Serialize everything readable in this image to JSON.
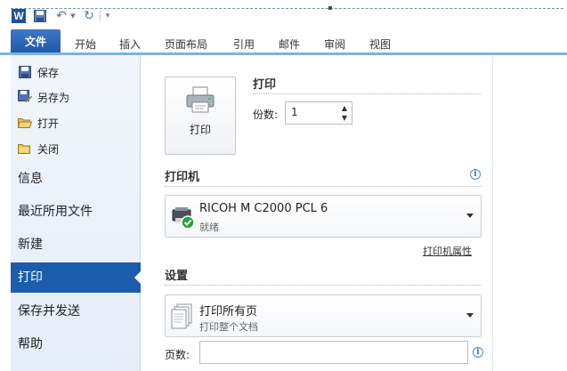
{
  "qat": {
    "logo_letter": "W",
    "icons": [
      "word-logo-icon",
      "save-icon",
      "undo-icon",
      "redo-icon",
      "customize-icon"
    ]
  },
  "ribbon": {
    "tabs": [
      {
        "label": "文件"
      },
      {
        "label": "开始"
      },
      {
        "label": "插入"
      },
      {
        "label": "页面布局"
      },
      {
        "label": "引用"
      },
      {
        "label": "邮件"
      },
      {
        "label": "审阅"
      },
      {
        "label": "视图"
      }
    ]
  },
  "backstage": {
    "commands": [
      {
        "label": "保存",
        "icon": "save-icon"
      },
      {
        "label": "另存为",
        "icon": "save-as-icon"
      },
      {
        "label": "打开",
        "icon": "open-folder-icon"
      },
      {
        "label": "关闭",
        "icon": "close-folder-icon"
      }
    ],
    "tabs": [
      {
        "label": "信息"
      },
      {
        "label": "最近所用文件"
      },
      {
        "label": "新建"
      },
      {
        "label": "打印",
        "selected": true
      },
      {
        "label": "保存并发送"
      },
      {
        "label": "帮助"
      }
    ]
  },
  "print": {
    "button_label": "打印",
    "heading": "打印",
    "copies_label": "份数:",
    "copies_value": "1"
  },
  "printer": {
    "heading": "打印机",
    "name": "RICOH M C2000 PCL 6",
    "status": "就绪",
    "properties_link": "打印机属性"
  },
  "settings": {
    "heading": "设置",
    "pages_option": "打印所有页",
    "pages_option_desc": "打印整个文档",
    "pages_label": "页数:",
    "pages_value": ""
  },
  "colors": {
    "file_tab": "#2a63b5",
    "selected_nav": "#1b5daa",
    "ribbon_line": "#7fb2e0"
  }
}
